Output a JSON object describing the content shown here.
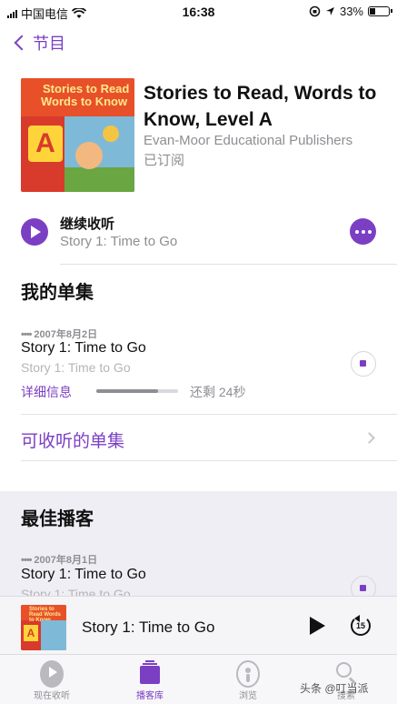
{
  "status_bar": {
    "carrier": "中国电信",
    "time": "16:38",
    "battery": "33%",
    "battery_level": 0.33
  },
  "nav": {
    "back_label": "节目"
  },
  "podcast": {
    "title": "Stories to Read, Words to Know, Level A",
    "publisher": "Evan-Moor Educational Publishers",
    "status": "已订阅",
    "cover": {
      "line1": "Stories to Read",
      "line2": "Words to Know",
      "letter": "A"
    }
  },
  "continue": {
    "label": "继续收听",
    "episode": "Story 1: Time to Go"
  },
  "my_episodes": {
    "heading": "我的单集",
    "episode": {
      "date": "2007年8月2日",
      "title": "Story 1: Time to Go",
      "subtitle": "Story 1: Time to Go",
      "details_label": "详细信息",
      "remaining": "还剩 24秒",
      "progress": 0.75
    }
  },
  "available_episodes": {
    "label": "可收听的单集"
  },
  "top_podcasts": {
    "heading": "最佳播客",
    "episode": {
      "date": "2007年8月1日",
      "title": "Story 1: Time to Go",
      "subtitle": "Story 1: Time to Go"
    }
  },
  "mini_player": {
    "title": "Story 1: Time to Go",
    "skip_seconds": "15",
    "cover": {
      "line": "Stories to Read Words to Know",
      "letter": "A"
    }
  },
  "tabs": [
    {
      "label": "现在收听",
      "icon": "play-circle-icon",
      "active": false
    },
    {
      "label": "播客库",
      "icon": "library-icon",
      "active": true
    },
    {
      "label": "浏览",
      "icon": "podcast-icon",
      "active": false
    },
    {
      "label": "搜索",
      "icon": "search-icon",
      "active": false
    }
  ],
  "watermark": "头条 @叮当派",
  "colors": {
    "accent": "#7b3fc4",
    "secondary_text": "#8e8e93"
  }
}
